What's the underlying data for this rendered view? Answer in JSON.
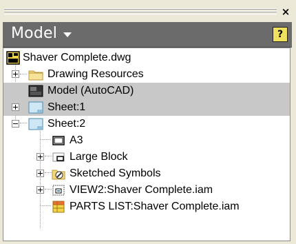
{
  "panel": {
    "title": "Model",
    "help_label": "?"
  },
  "tree": [
    {
      "label": "Shaver Complete.dwg",
      "icon": "drawing-file-icon"
    },
    {
      "label": "Drawing Resources",
      "icon": "folder-icon",
      "expander": "plus"
    },
    {
      "label": "Model (AutoCAD)",
      "icon": "autocad-model-icon",
      "selected": true
    },
    {
      "label": "Sheet:1",
      "icon": "sheet-icon",
      "expander": "plus",
      "selected": true
    },
    {
      "label": "Sheet:2",
      "icon": "sheet-icon",
      "expander": "minus"
    },
    {
      "label": "A3",
      "icon": "border-icon"
    },
    {
      "label": "Large Block",
      "icon": "title-block-icon",
      "expander": "plus"
    },
    {
      "label": "Sketched Symbols",
      "icon": "sketched-symbols-icon",
      "expander": "plus"
    },
    {
      "label": "VIEW2:Shaver Complete.iam",
      "icon": "drawing-view-icon",
      "expander": "plus"
    },
    {
      "label": "PARTS LIST:Shaver Complete.iam",
      "icon": "parts-list-icon"
    }
  ]
}
